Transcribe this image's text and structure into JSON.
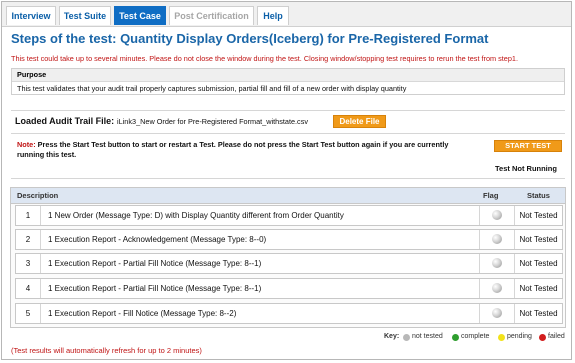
{
  "tabs": [
    {
      "label": "Interview",
      "state": "normal"
    },
    {
      "label": "Test Suite",
      "state": "normal"
    },
    {
      "label": "Test Case",
      "state": "active"
    },
    {
      "label": "Post Certification",
      "state": "disabled"
    },
    {
      "label": "Help",
      "state": "normal"
    }
  ],
  "page_title": "Steps of the test: Quantity Display Orders(Iceberg) for Pre-Registered Format",
  "warning": "This test could take up to several minutes. Please do not close the window during the test. Closing window/stopping test requires to rerun the test from step1.",
  "purpose": {
    "heading": "Purpose",
    "text": "This test validates that your audit trail properly captures submission, partial fill and fill of a new order with display quantity"
  },
  "audit_trail": {
    "label": "Loaded Audit Trail File:",
    "file": "iLink3_New Order for Pre-Registered Format_withstate.csv",
    "delete_label": "Delete File"
  },
  "note": {
    "label": "Note:",
    "text": " Press the Start Test button to start or restart a Test. Please do not press the Start Test button again if you are currently running this test."
  },
  "start_label": "START TEST",
  "test_status": "Test Not Running",
  "table": {
    "headers": {
      "description": "Description",
      "flag": "Flag",
      "status": "Status"
    },
    "rows": [
      {
        "num": "1",
        "description": "1 New Order (Message Type: D) with Display Quantity different from Order Quantity",
        "status": "Not Tested"
      },
      {
        "num": "2",
        "description": "1 Execution Report - Acknowledgement (Message Type: 8--0)",
        "status": "Not Tested"
      },
      {
        "num": "3",
        "description": "1 Execution Report - Partial Fill Notice (Message Type: 8--1)",
        "status": "Not Tested"
      },
      {
        "num": "4",
        "description": "1 Execution Report - Partial Fill Notice (Message Type: 8--1)",
        "status": "Not Tested"
      },
      {
        "num": "5",
        "description": "1 Execution Report - Fill Notice (Message Type: 8--2)",
        "status": "Not Tested"
      }
    ]
  },
  "key": {
    "label": "Key:",
    "items": [
      {
        "label": "not tested",
        "color": "#b8b8b8"
      },
      {
        "label": "complete",
        "color": "#2e9e2e"
      },
      {
        "label": "pending",
        "color": "#f2e21a"
      },
      {
        "label": "failed",
        "color": "#d21d1d"
      }
    ]
  },
  "refresh_note": "(Test results will automatically refresh for up to 2 minutes)",
  "colors": {
    "tab_active": "#0f6dc4",
    "title": "#1a66a8",
    "warning": "#c01414",
    "button": "#f09a19"
  }
}
